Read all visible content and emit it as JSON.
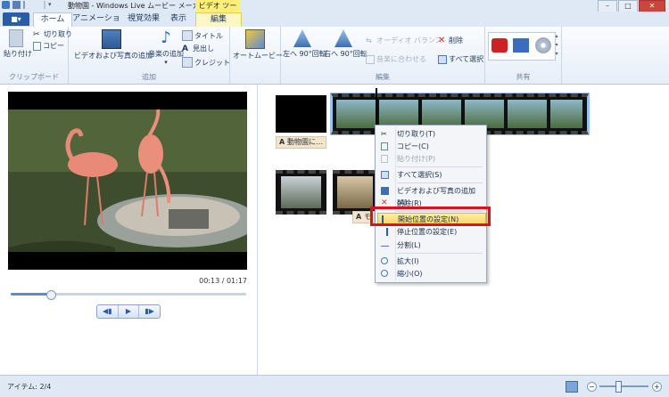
{
  "window": {
    "title": "動物園 - Windows Live ムービー メーカー",
    "context_tab_group": "ビデオ ツール",
    "minimize": "–",
    "maximize": "□",
    "close": "✕"
  },
  "tabs": {
    "app_menu": "■▾",
    "items": [
      "ホーム",
      "アニメーション",
      "視覚効果",
      "表示"
    ],
    "context_tab": "編集"
  },
  "ribbon": {
    "clipboard": {
      "label": "クリップボード",
      "paste": "貼り付け",
      "cut": "切り取り",
      "copy": "コピー"
    },
    "add": {
      "label": "追加",
      "add_media": "ビデオおよび写真の追加",
      "add_music": "音楽の追加",
      "title": "タイトル",
      "caption": "見出し",
      "credits": "クレジット"
    },
    "automovie": "オートムービー",
    "edit": {
      "label": "編集",
      "rotate_left": "左へ 90°回転",
      "rotate_right": "右へ 90°回転",
      "audio_balance": "オーディオ バランス",
      "delete": "削除",
      "fit_to_music": "音楽に合わせる",
      "select_all": "すべて選択"
    },
    "share": {
      "label": "共有"
    }
  },
  "player": {
    "time": "00:13 / 01:17",
    "progress_fraction": 0.17,
    "prev": "◀▮",
    "play": "▶",
    "next": "▮▶"
  },
  "storyboard": {
    "caption_1": "動物園に…",
    "caption_2": "モ"
  },
  "context_menu": {
    "items": [
      {
        "label": "切り取り(T)",
        "enabled": true
      },
      {
        "label": "コピー(C)",
        "enabled": true
      },
      {
        "label": "貼り付け(P)",
        "enabled": false
      },
      {
        "label": "すべて選択(S)",
        "enabled": true
      },
      {
        "label": "ビデオおよび写真の追加(A)",
        "enabled": true
      },
      {
        "label": "削除(R)",
        "enabled": true
      },
      {
        "label": "開始位置の設定(N)",
        "enabled": true,
        "highlighted": true
      },
      {
        "label": "停止位置の設定(E)",
        "enabled": true
      },
      {
        "label": "分割(L)",
        "enabled": true
      },
      {
        "label": "拡大(I)",
        "enabled": true
      },
      {
        "label": "縮小(O)",
        "enabled": true
      }
    ]
  },
  "status": {
    "items": "アイテム: 2/4"
  },
  "colors": {
    "highlight_box": "#e0101a",
    "ribbon_bg": "#e7eef8",
    "context_tab": "#fbee7a"
  }
}
